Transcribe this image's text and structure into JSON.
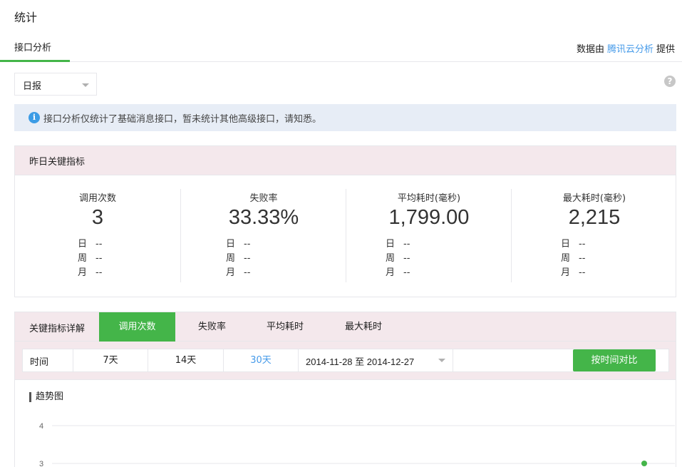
{
  "page": {
    "title": "统计"
  },
  "tabs": {
    "active_label": "接口分析"
  },
  "provider": {
    "prefix": "数据由",
    "link": "腾讯云分析",
    "suffix": "提供"
  },
  "report_select": {
    "value": "日报"
  },
  "help_icon": {
    "glyph": "?"
  },
  "notice": {
    "icon": "i",
    "text": "接口分析仅统计了基础消息接口，暂未统计其他高级接口，请知悉。"
  },
  "kpi": {
    "title": "昨日关键指标",
    "row_keys": [
      "日",
      "周",
      "月"
    ],
    "items": [
      {
        "label": "调用次数",
        "value": "3",
        "day": "--",
        "week": "--",
        "month": "--"
      },
      {
        "label": "失败率",
        "value": "33.33%",
        "day": "--",
        "week": "--",
        "month": "--"
      },
      {
        "label": "平均耗时(毫秒)",
        "value": "1,799.00",
        "day": "--",
        "week": "--",
        "month": "--"
      },
      {
        "label": "最大耗时(毫秒)",
        "value": "2,215",
        "day": "--",
        "week": "--",
        "month": "--"
      }
    ]
  },
  "detail": {
    "title": "关键指标详解",
    "tabs": [
      "调用次数",
      "失败率",
      "平均耗时",
      "最大耗时"
    ],
    "active_tab": 0,
    "filter": {
      "label": "时间",
      "ranges": [
        "7天",
        "14天",
        "30天"
      ],
      "active_range": 2,
      "date_range": "2014-11-28 至 2014-12-27",
      "compare_button": "按时间对比"
    },
    "trend_title": "趋势图"
  },
  "chart_data": {
    "type": "line",
    "ylim": [
      3,
      4
    ],
    "yticks": [
      "4",
      "3"
    ],
    "series": [
      {
        "values": [
          3
        ]
      }
    ],
    "point_color": "#44b549",
    "grid": true
  },
  "colors": {
    "accent": "#44b549",
    "link": "#459ae9",
    "panel_head": "#f4e8ec",
    "notice_bg": "#e7edf6"
  }
}
